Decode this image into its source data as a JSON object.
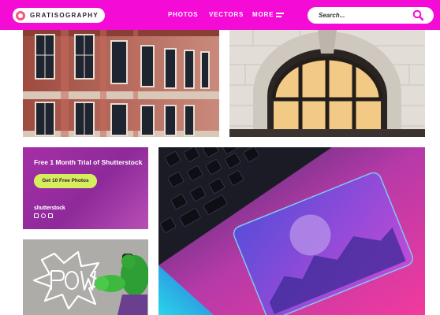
{
  "header": {
    "logo_text": "GRATISOGRAPHY",
    "nav": {
      "photos": "PHOTOS",
      "vectors": "VECTORS",
      "more": "MORE"
    },
    "search": {
      "placeholder": "Search..."
    },
    "brand_color": "#f50bd6"
  },
  "ad": {
    "title": "Free 1 Month Trial of Shutterstock",
    "button_label": "Get 10 Free Photos",
    "brand": "shutterstock",
    "icons": [
      "camera-icon",
      "music-icon",
      "video-icon"
    ],
    "button_color": "#d7ee5c"
  },
  "tiles": [
    {
      "name": "building-facade-photo"
    },
    {
      "name": "stone-arch-window-photo"
    },
    {
      "name": "laptop-trackpad-photo"
    },
    {
      "name": "pow-comic-hulk-photo"
    }
  ]
}
